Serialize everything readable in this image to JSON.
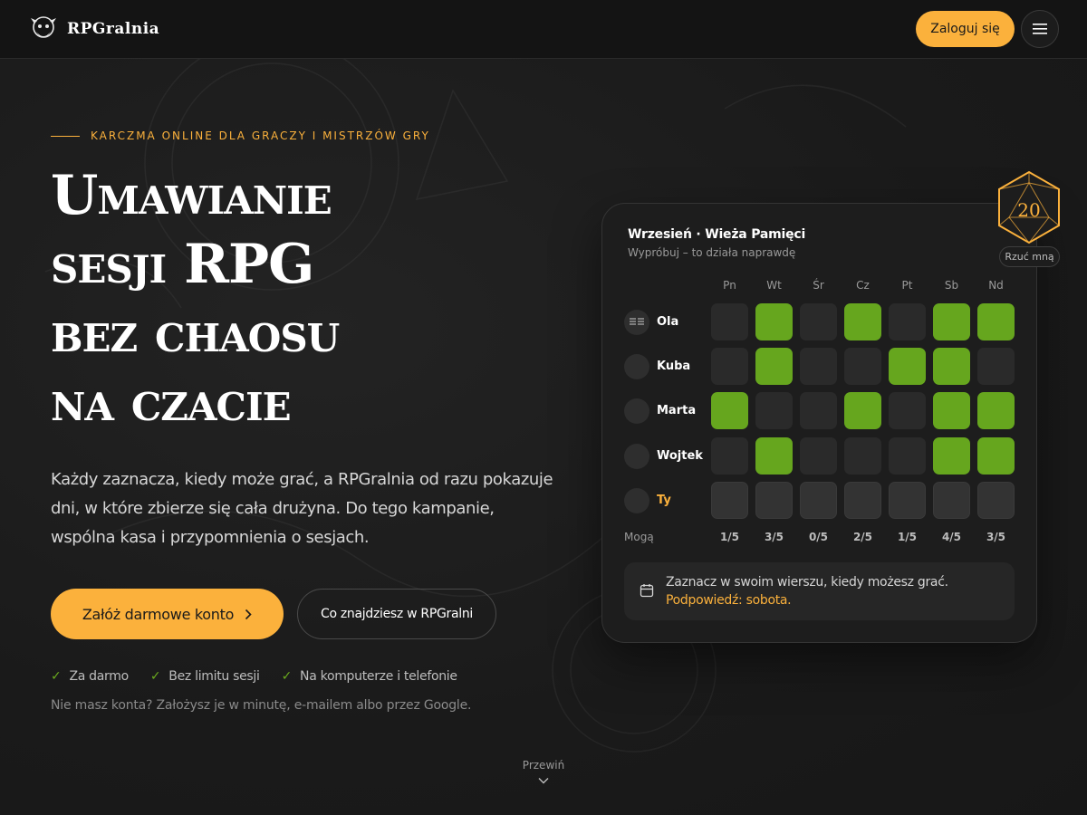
{
  "header": {
    "brand": "RPGralnia",
    "login_label": "Zaloguj się",
    "menu_icon": "hamburger-icon"
  },
  "hero": {
    "eyebrow": "KARCZMA ONLINE DLA GRACZY I MISTRZÓW GRY",
    "title_lines": [
      "Umawianie",
      "sesji RPG",
      "bez chaosu",
      "na czacie"
    ],
    "description": "Każdy zaznacza, kiedy może grać, a RPGralnia od razu pokazuje dni, w które zbierze się cała drużyna. Do tego kampanie, wspólna kasa i przypomnienia o sesjach.",
    "cta_primary": "Załóż darmowe konto",
    "cta_secondary": "Co znajdziesz w RPGralni",
    "perks": [
      "Za darmo",
      "Bez limitu sesji",
      "Na komputerze i telefonie"
    ],
    "note": "Nie masz konta? Założysz je w minutę, e-mailem albo przez Google."
  },
  "scroll_hint": "Przewiń",
  "schedule": {
    "title": "Wrzesień · Wieża Pamięci",
    "subtitle": "Wypróbuj – to działa naprawdę",
    "days": [
      "Pn",
      "Wt",
      "Śr",
      "Cz",
      "Pt",
      "Sb",
      "Nd"
    ],
    "players": [
      {
        "name": "Ola",
        "availability": [
          0,
          1,
          0,
          1,
          0,
          1,
          1
        ],
        "is_me": false
      },
      {
        "name": "Kuba",
        "availability": [
          0,
          1,
          0,
          0,
          1,
          1,
          0
        ],
        "is_me": false
      },
      {
        "name": "Marta",
        "availability": [
          1,
          0,
          0,
          1,
          0,
          1,
          1
        ],
        "is_me": false
      },
      {
        "name": "Wojtek",
        "availability": [
          0,
          1,
          0,
          0,
          0,
          1,
          1
        ],
        "is_me": false
      },
      {
        "name": "Ty",
        "availability": [
          0,
          0,
          0,
          0,
          0,
          0,
          0
        ],
        "is_me": true
      }
    ],
    "count_label": "Mogą",
    "counts": [
      "1/5",
      "3/5",
      "0/5",
      "2/5",
      "1/5",
      "4/5",
      "3/5"
    ],
    "hint": "Zaznacz w swoim wierszu, kiedy możesz grać.",
    "hint_accent": "Podpowiedź: sobota.",
    "colors": {
      "available": "#66a61e",
      "accent": "#fbb13c"
    }
  },
  "die": {
    "value": "20",
    "label": "Rzuć mną"
  }
}
